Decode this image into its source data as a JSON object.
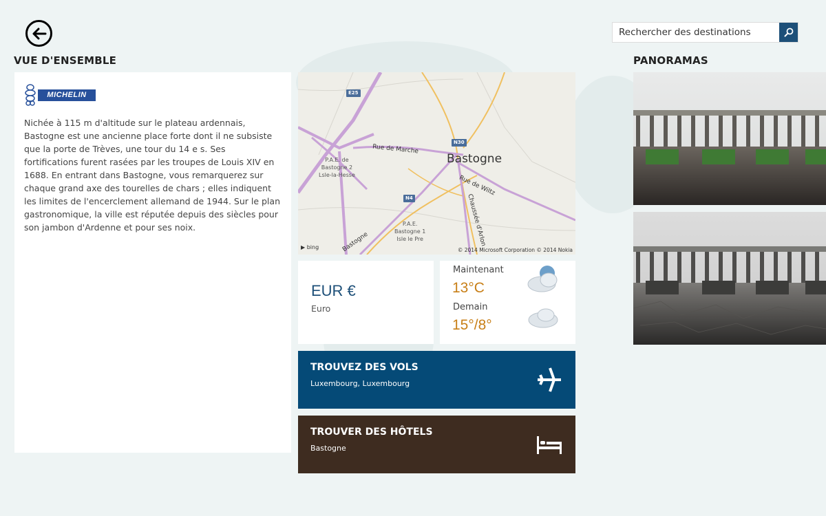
{
  "header": {
    "back_label": "Back",
    "search_placeholder": "Rechercher des destinations"
  },
  "overview": {
    "title": "VUE D'ENSEMBLE",
    "logo_text": "MICHELIN",
    "text": "Nichée à 115 m d'altitude sur le plateau ardennais, Bastogne est une ancienne place forte dont il ne subsiste que la porte de Trèves, une tour du 14 e s. Ses fortifications furent rasées par les troupes de Louis XIV en 1688. En entrant dans Bastogne, vous remarquerez sur chaque grand axe des tourelles de chars ; elles indiquent les limites de l'encerclement allemand de 1944. Sur le plan gastronomique, la ville est réputée depuis des siècles pour son jambon d'Ardenne et pour ses noix."
  },
  "map": {
    "town": "Bastogne",
    "street_marche": "Rue de Marche",
    "street_wiltz": "Rue de Wiltz",
    "street_arlon": "Chaussée d'Arlon",
    "street_partial": "Bastogne",
    "pae2": "P.A.E. de\nBastogne 2\nLsle-la-Hesse",
    "pae1": "P.A.E.\nBastogne 1\nIsle le Pre",
    "shield_e25": "E25",
    "shield_n30": "N30",
    "shield_n4": "N4",
    "bing": "bing",
    "copyright": "© 2014 Microsoft Corporation © 2014 Nokia"
  },
  "currency": {
    "code": "EUR €",
    "name": "Euro"
  },
  "weather": {
    "now_label": "Maintenant",
    "now_temp": "13°C",
    "now_icon": "partly-cloudy-icon",
    "tomorrow_label": "Demain",
    "tomorrow_temp": "15°/8°",
    "tomorrow_icon": "cloudy-icon"
  },
  "flights": {
    "title": "TROUVEZ DES VOLS",
    "subtitle": "Luxembourg, Luxembourg",
    "color": "#054a77",
    "icon": "airplane-icon"
  },
  "hotels": {
    "title": "TROUVER DES HÔTELS",
    "subtitle": "Bastogne",
    "color": "#3e2c20",
    "icon": "bed-icon"
  },
  "panoramas": {
    "title": "PANORAMAS"
  }
}
